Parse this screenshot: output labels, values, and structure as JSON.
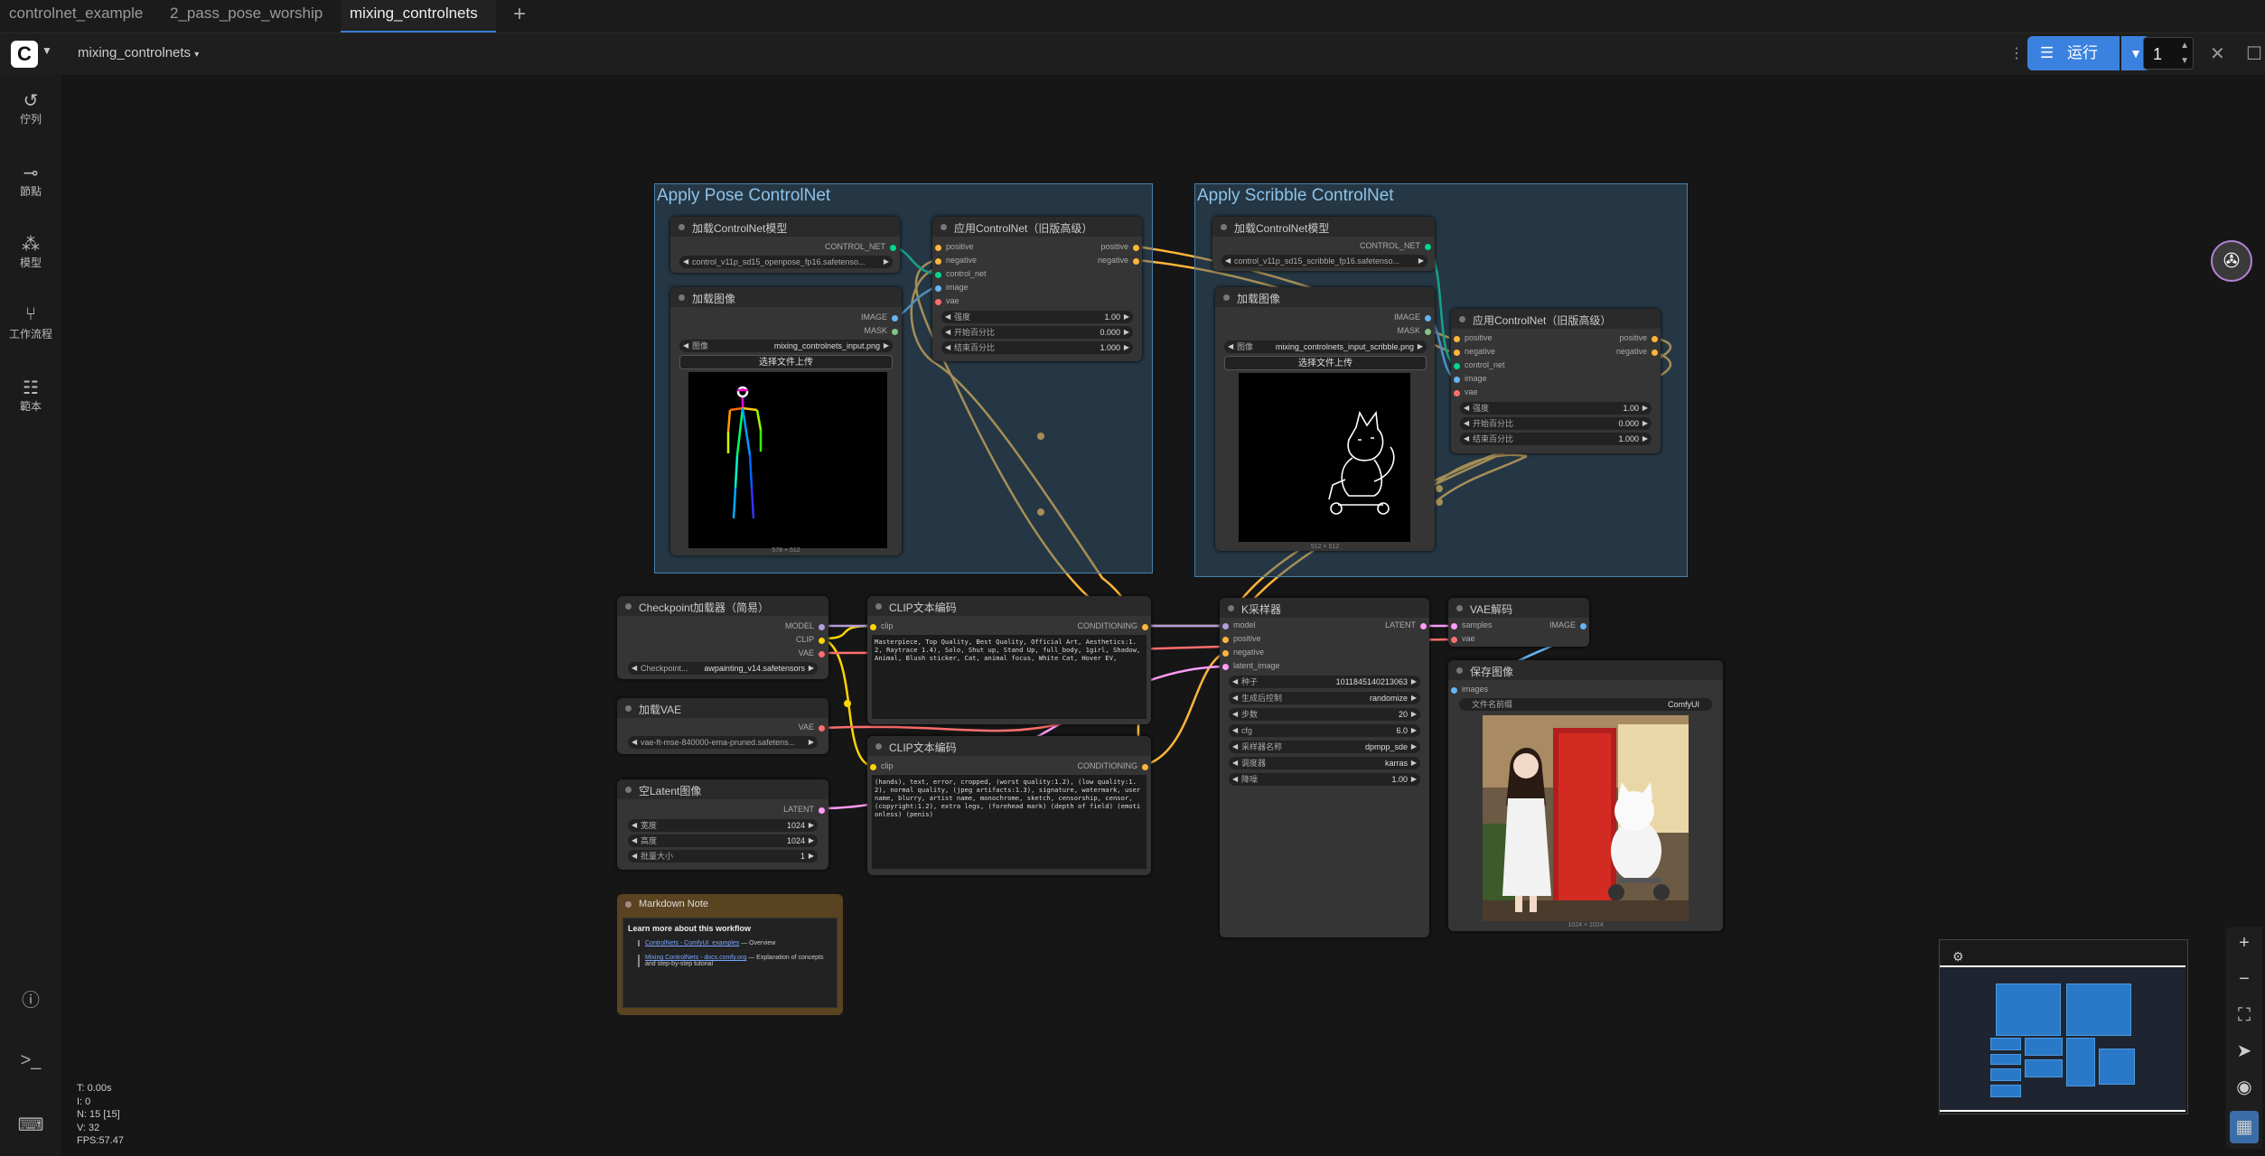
{
  "tabs": [
    {
      "label": "controlnet_example"
    },
    {
      "label": "2_pass_pose_worship"
    },
    {
      "label": "mixing_controlnets"
    }
  ],
  "header": {
    "workflow_name": "mixing_controlnets",
    "run_label": "运行",
    "run_count": "1"
  },
  "sidebar": {
    "items": [
      {
        "label": "佇列",
        "icon": "history-icon"
      },
      {
        "label": "節點",
        "icon": "node-icon"
      },
      {
        "label": "模型",
        "icon": "model-icon"
      },
      {
        "label": "工作流程",
        "icon": "workflow-icon"
      },
      {
        "label": "範本",
        "icon": "template-icon"
      }
    ]
  },
  "stats": {
    "t": "T: 0.00s",
    "i": "I: 0",
    "n": "N: 15 [15]",
    "v": "V: 32",
    "fps": "FPS:57.47"
  },
  "groups": {
    "pose": {
      "title": "Apply Pose ControlNet"
    },
    "scribble": {
      "title": "Apply Scribble ControlNet"
    }
  },
  "nodes": {
    "pose_cn_loader": {
      "title": "加载ControlNet模型",
      "output": "CONTROL_NET",
      "model": "control_v11p_sd15_openpose_fp16.safetenso..."
    },
    "pose_apply": {
      "title": "应用ControlNet（旧版高级）",
      "inputs": [
        "positive",
        "negative",
        "control_net",
        "image",
        "vae"
      ],
      "outputs": [
        "positive",
        "negative"
      ],
      "widgets": [
        {
          "k": "强度",
          "v": "1.00"
        },
        {
          "k": "开始百分比",
          "v": "0.000"
        },
        {
          "k": "结束百分比",
          "v": "1.000"
        }
      ]
    },
    "pose_load_image": {
      "title": "加载图像",
      "outputs": [
        "IMAGE",
        "MASK"
      ],
      "image_label": "图像",
      "image_value": "mixing_controlnets_input.png",
      "upload": "选择文件上传",
      "dims": "578 × 512"
    },
    "scrib_cn_loader": {
      "title": "加载ControlNet模型",
      "output": "CONTROL_NET",
      "model": "control_v11p_sd15_scribble_fp16.safetenso..."
    },
    "scrib_load_image": {
      "title": "加载图像",
      "outputs": [
        "IMAGE",
        "MASK"
      ],
      "image_label": "图像",
      "image_value": "mixing_controlnets_input_scribble.png",
      "upload": "选择文件上传",
      "dims": "512 × 512"
    },
    "scrib_apply": {
      "title": "应用ControlNet（旧版高级）",
      "inputs": [
        "positive",
        "negative",
        "control_net",
        "image",
        "vae"
      ],
      "outputs": [
        "positive",
        "negative"
      ],
      "widgets": [
        {
          "k": "强度",
          "v": "1.00"
        },
        {
          "k": "开始百分比",
          "v": "0.000"
        },
        {
          "k": "结束百分比",
          "v": "1.000"
        }
      ]
    },
    "checkpoint": {
      "title": "Checkpoint加载器（简易）",
      "outputs": [
        "MODEL",
        "CLIP",
        "VAE"
      ],
      "k": "Checkpoint...",
      "v": "awpainting_v14.safetensors"
    },
    "vae_loader": {
      "title": "加载VAE",
      "output": "VAE",
      "v": "vae-ft-mse-840000-ema-pruned.safetens..."
    },
    "empty_latent": {
      "title": "空Latent图像",
      "output": "LATENT",
      "widgets": [
        {
          "k": "宽度",
          "v": "1024"
        },
        {
          "k": "高度",
          "v": "1024"
        },
        {
          "k": "批量大小",
          "v": "1"
        }
      ]
    },
    "clip_pos": {
      "title": "CLIP文本编码",
      "input": "clip",
      "output": "CONDITIONING",
      "text": "Masterpiece, Top Quality, Best Quality, Official Art, Aesthetics:1.2, Raytrace 1.4), Solo, Shut up, Stand Up, full_body, 1girl, Shadow, Animal, Blush sticker, Cat, animal focus, White Cat, Hover EV,"
    },
    "clip_neg": {
      "title": "CLIP文本编码",
      "input": "clip",
      "output": "CONDITIONING",
      "text": "(hands), text, error, cropped, (worst quality:1.2), (low quality:1.2), normal quality, (jpeg artifacts:1.3), signature, watermark, username, blurry, artist name, monochrome, sketch, censorship, censor, (copyright:1.2), extra legs, (forehead mark) (depth of field) (emotionless) (penis)"
    },
    "ksampler": {
      "title": "K采样器",
      "inputs": [
        "model",
        "positive",
        "negative",
        "latent_image"
      ],
      "output": "LATENT",
      "widgets": [
        {
          "k": "种子",
          "v": "1011845140213063"
        },
        {
          "k": "生成后控制",
          "v": "randomize"
        },
        {
          "k": "步数",
          "v": "20"
        },
        {
          "k": "cfg",
          "v": "6.0"
        },
        {
          "k": "采样器名称",
          "v": "dpmpp_sde"
        },
        {
          "k": "调度器",
          "v": "karras"
        },
        {
          "k": "降噪",
          "v": "1.00"
        }
      ]
    },
    "vae_decode": {
      "title": "VAE解码",
      "inputs": [
        "samples",
        "vae"
      ],
      "output": "IMAGE"
    },
    "save_image": {
      "title": "保存图像",
      "input": "images",
      "k": "文件名前缀",
      "v": "ComfyUI",
      "dims": "1024 × 1024"
    }
  },
  "note": {
    "title": "Markdown Note",
    "heading": "Learn more about this workflow",
    "links": [
      {
        "link": "ControlNets - ComfyUI_examples",
        "rest": " — Overview"
      },
      {
        "link": "Mixing ControlNets - docs.comfy.org",
        "rest": " — Explanation of concepts and step-by-step tutorial"
      }
    ]
  },
  "colors": {
    "accent": "#3b82e0",
    "group_fill": "#375f7d",
    "conditioning_link": "#ffb53a",
    "clip_link": "#ffd500",
    "model_link": "#b39ddb",
    "latent_link": "#ff9cf9",
    "vae_link": "#ff6e6e",
    "image_link": "#64b5f6",
    "controlnet_link": "#00d78d"
  }
}
